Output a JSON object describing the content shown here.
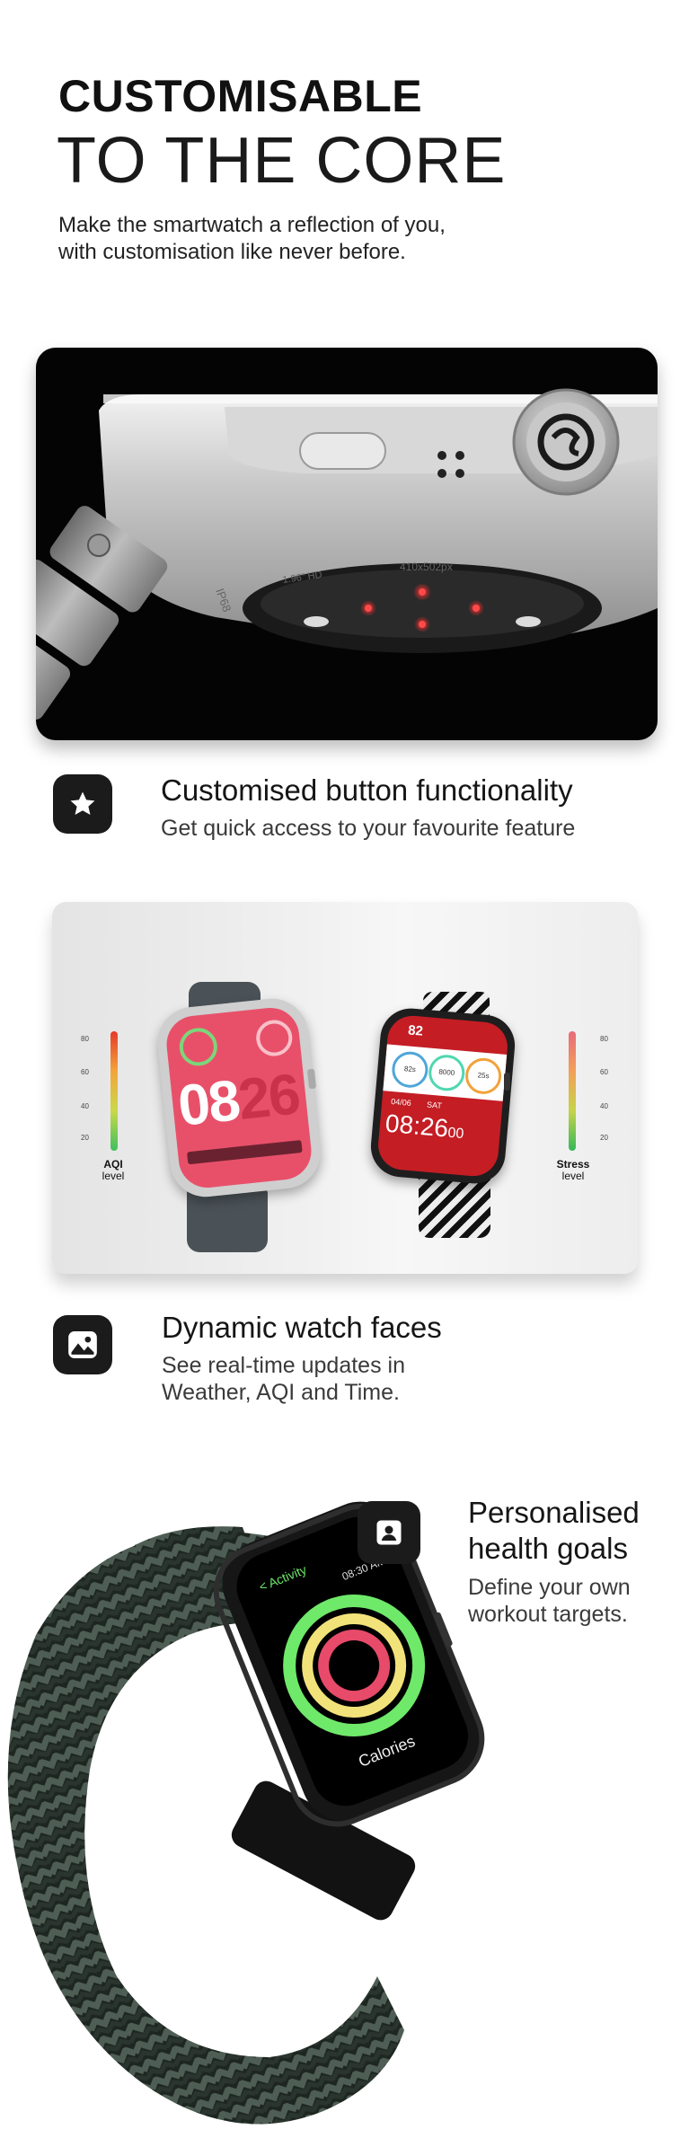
{
  "header": {
    "title_line1": "CUSTOMISABLE",
    "title_line2": "TO THE CORE",
    "intro": "Make the smartwatch a reflection of you, with customisation like never before."
  },
  "crown_image": {
    "engraving_left": "IP68",
    "engraving_mid": "410x502px",
    "engraving_tail": "1.96\" HD"
  },
  "features": [
    {
      "title": "Customised button functionality",
      "desc": "Get quick access to your favourite feature",
      "icon": "star-icon"
    },
    {
      "title": "Dynamic watch faces",
      "desc": "See real-time updates in Weather, AQI and Time.",
      "icon": "gallery-icon"
    },
    {
      "title": "Personalised health goals",
      "desc": "Define your own workout targets.",
      "icon": "user-icon"
    }
  ],
  "faces_card": {
    "aqi_scale": [
      "80",
      "60",
      "40",
      "20"
    ],
    "aqi_label_bold": "AQI",
    "aqi_label": "level",
    "stress_scale": [
      "80",
      "60",
      "40",
      "20"
    ],
    "stress_label_bold": "Stress",
    "stress_label": "level",
    "watch1_time_hours": "08",
    "watch1_time_minutes": "26",
    "watch2_number": "82",
    "watch2_date": "04/06",
    "watch2_day": "SAT",
    "watch2_time": "08:26",
    "watch2_seconds": "00",
    "watch2_dial1": "82s",
    "watch2_dial2": "8000",
    "watch2_dial3": "25s"
  },
  "health_watch": {
    "screen_title": "< Activity",
    "screen_time": "08:30 AM",
    "screen_metric": "Calories"
  },
  "colors": {
    "icon_bg": "#1b1b1b",
    "watch1_face": "#e8506a",
    "watch2_face": "#c41d24",
    "ring_outer": "#6fe96a",
    "ring_mid": "#f2e27a",
    "ring_inner": "#e84a6a"
  }
}
